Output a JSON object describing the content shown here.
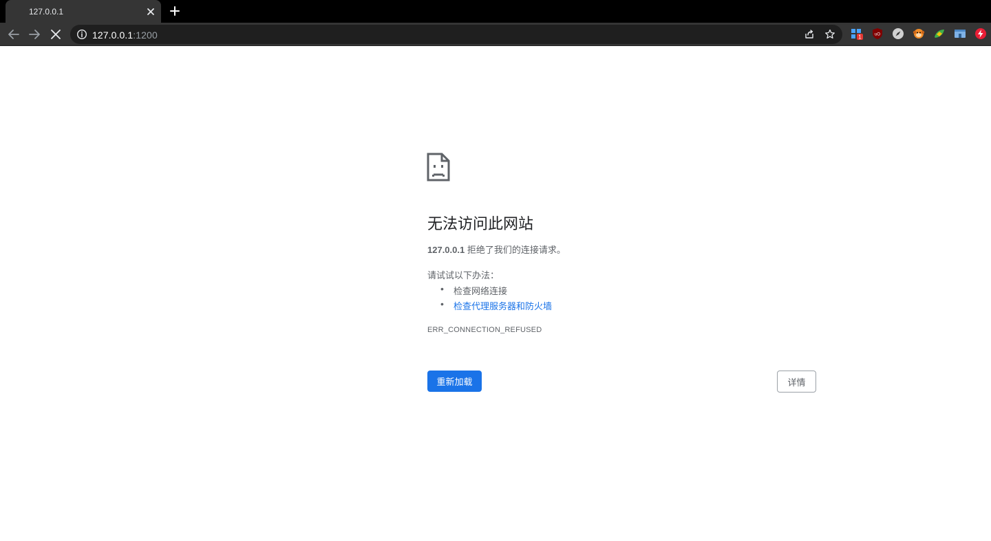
{
  "browser": {
    "tab": {
      "title": "127.0.0.1",
      "close_icon": "close-icon"
    },
    "new_tab_icon": "plus-icon",
    "nav": {
      "back_icon": "arrow-left-icon",
      "forward_icon": "arrow-right-icon",
      "stop_icon": "close-icon"
    },
    "omnibox": {
      "info_icon": "info-icon",
      "url_host": "127.0.0.1",
      "url_port": ":1200",
      "share_icon": "share-icon",
      "bookmark_icon": "star-icon"
    },
    "extensions": [
      {
        "icon": "puzzle-icon",
        "badge": "1"
      },
      {
        "icon": "ublock-icon",
        "badge": ""
      },
      {
        "icon": "compass-icon",
        "badge": ""
      },
      {
        "icon": "monkey-icon",
        "badge": ""
      },
      {
        "icon": "leaf-icon",
        "badge": ""
      },
      {
        "icon": "window-icon",
        "badge": ""
      },
      {
        "icon": "lightning-icon",
        "badge": ""
      }
    ]
  },
  "error_page": {
    "icon": "sad-document-icon",
    "heading": "无法访问此网站",
    "host": "127.0.0.1",
    "refused_text": " 拒绝了我们的连接请求。",
    "try_text": "请试试以下办法：",
    "suggestions": [
      {
        "text": "检查网络连接",
        "is_link": false
      },
      {
        "text": "检查代理服务器和防火墙",
        "is_link": true
      }
    ],
    "error_code": "ERR_CONNECTION_REFUSED",
    "reload_label": "重新加载",
    "details_label": "详情"
  },
  "colors": {
    "accent": "#1a73e8",
    "toolbar_bg": "#353535",
    "tabstrip_bg": "#000000",
    "text_secondary": "#5f6368",
    "heading": "#202124"
  }
}
